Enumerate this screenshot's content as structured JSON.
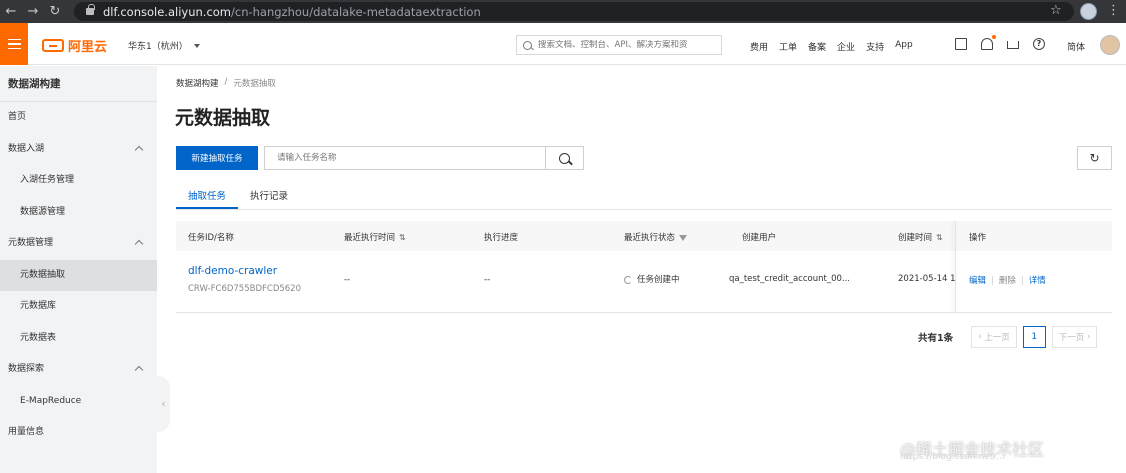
{
  "browser": {
    "url_host": "dlf.console.aliyun.com",
    "url_path": "/cn-hangzhou/datalake-metadataextraction"
  },
  "header": {
    "logo_text": "阿里云",
    "region": "华东1（杭州）",
    "search_placeholder": "搜索文档、控制台、API、解决方案和资",
    "nav": [
      "费用",
      "工单",
      "备案",
      "企业",
      "支持",
      "App"
    ],
    "language": "简体"
  },
  "sidebar": {
    "title": "数据湖构建",
    "items": [
      {
        "label": "首页"
      },
      {
        "label": "数据入湖"
      },
      {
        "label": "入湖任务管理"
      },
      {
        "label": "数据源管理"
      },
      {
        "label": "元数据管理"
      },
      {
        "label": "元数据抽取"
      },
      {
        "label": "元数据库"
      },
      {
        "label": "元数据表"
      },
      {
        "label": "数据探索"
      },
      {
        "label": "E-MapReduce"
      },
      {
        "label": "用量信息"
      }
    ]
  },
  "breadcrumb": {
    "parent": "数据湖构建",
    "separator": "/",
    "current": "元数据抽取"
  },
  "page": {
    "title": "元数据抽取",
    "new_button": "新建抽取任务",
    "search_placeholder": "请输入任务名称"
  },
  "tabs": [
    {
      "label": "抽取任务"
    },
    {
      "label": "执行记录"
    }
  ],
  "table": {
    "columns": [
      "任务ID/名称",
      "最近执行时间",
      "执行进度",
      "最近执行状态",
      "创建用户",
      "创建时间",
      "操作"
    ],
    "rows": [
      {
        "name": "dlf-demo-crawler",
        "id": "CRW-FC6D755BDFCD5620",
        "last_run": "--",
        "progress": "--",
        "status": "任务创建中",
        "creator": "qa_test_credit_account_00...",
        "created": "2021-05-14 1",
        "actions": [
          "编辑",
          "删除",
          "详情"
        ]
      }
    ]
  },
  "pagination": {
    "total": "共有1条",
    "prev": "上一页",
    "page": "1",
    "next": "下一页"
  },
  "watermark": {
    "text": "@稀土掘金技术社区",
    "url": "https://blog.csdn.net/..."
  }
}
